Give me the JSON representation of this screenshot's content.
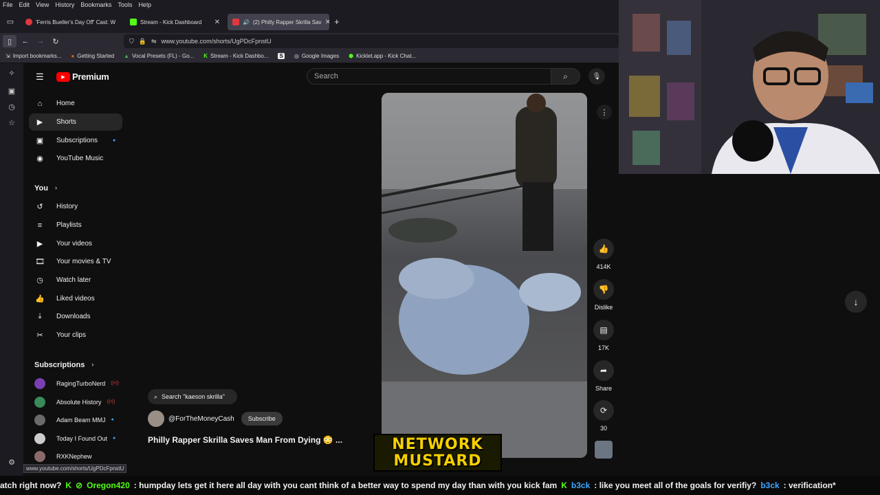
{
  "menubar": [
    "File",
    "Edit",
    "View",
    "History",
    "Bookmarks",
    "Tools",
    "Help"
  ],
  "tabs": [
    {
      "title": "'Ferris Bueller's Day Off' Cast: W",
      "color": "#e0383e"
    },
    {
      "title": "Stream - Kick Dashboard",
      "color": "#53fc18"
    },
    {
      "title": "(2) Philly Rapper Skrilla Sav",
      "color": "#e0383e"
    }
  ],
  "url": "www.youtube.com/shorts/UgPDcFpnstU",
  "bookmarks": [
    "Import bookmarks...",
    "Getting Started",
    "Vocal Presets (FL) - Go...",
    "Stream - Kick Dashbo...",
    "",
    "Google Images",
    "Kicklet.app - Kick Chat..."
  ],
  "youtube": {
    "logo_text": "Premium",
    "search_placeholder": "Search",
    "nav": [
      "Home",
      "Shorts",
      "Subscriptions",
      "YouTube Music"
    ],
    "you_heading": "You",
    "you_items": [
      "History",
      "Playlists",
      "Your videos",
      "Your movies & TV",
      "Watch later",
      "Liked videos",
      "Downloads",
      "Your clips"
    ],
    "subs_heading": "Subscriptions",
    "subscriptions": [
      {
        "name": "RagingTurboNerd",
        "badge": "live",
        "color": "#7a3fb0"
      },
      {
        "name": "Absolute History",
        "badge": "live",
        "color": "#3a8a5a"
      },
      {
        "name": "Adam Beam MMJ",
        "badge": "dot",
        "color": "#6b6b6b"
      },
      {
        "name": "Today I Found Out",
        "badge": "dot",
        "color": "#cccccc"
      },
      {
        "name": "RXKNephew",
        "badge": "",
        "color": "#8a6a6a"
      }
    ],
    "actions": [
      {
        "icon": "thumbs-up-icon",
        "glyph": "👍",
        "label": "414K"
      },
      {
        "icon": "thumbs-down-icon",
        "glyph": "👎",
        "label": "Dislike"
      },
      {
        "icon": "comment-icon",
        "glyph": "▤",
        "label": "17K"
      },
      {
        "icon": "share-icon",
        "glyph": "➦",
        "label": "Share"
      },
      {
        "icon": "remix-icon",
        "glyph": "⟳",
        "label": "30"
      }
    ],
    "search_pill": "Search \"kaeson skrilla\"",
    "channel_name": "@ForTheMoneyCash",
    "subscribe_label": "Subscribe",
    "video_title": "Philly Rapper Skrilla Saves Man From Dying 😳 ...",
    "status_url": "www.youtube.com/shorts/UgPDcFpnstU"
  },
  "overlay_logo": [
    "NETWORK",
    "MUSTARD"
  ],
  "ticker": [
    {
      "text": "atch right now?",
      "color": "#f1f1f1"
    },
    {
      "text": "Oregon420",
      "color": "#53fc18"
    },
    {
      "text": ": humpday lets get it here all day with you cant think of a better way to spend my day than with you kick fam",
      "color": "#f1f1f1"
    },
    {
      "text": "b3ck",
      "color": "#3ea6ff"
    },
    {
      "text": ": like you meet all of the goals for verifiy?",
      "color": "#f1f1f1"
    },
    {
      "text": "b3ck",
      "color": "#3ea6ff"
    },
    {
      "text": ": verification*",
      "color": "#f1f1f1"
    }
  ]
}
